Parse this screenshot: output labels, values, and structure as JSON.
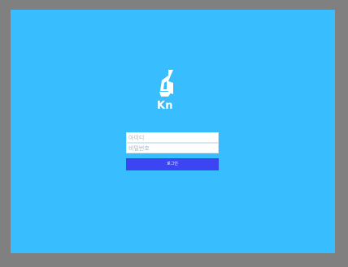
{
  "colors": {
    "frame": "#808080",
    "panel": "#38bdff",
    "button": "#3d45f2",
    "field": "#ffffff",
    "text_light": "#ffffff"
  },
  "brand": {
    "logo_icon": "boat-logo-icon",
    "name_visible": "Kn"
  },
  "login_form": {
    "username_placeholder": "아이디",
    "password_placeholder": "비밀번호",
    "submit_label": "로그인"
  }
}
